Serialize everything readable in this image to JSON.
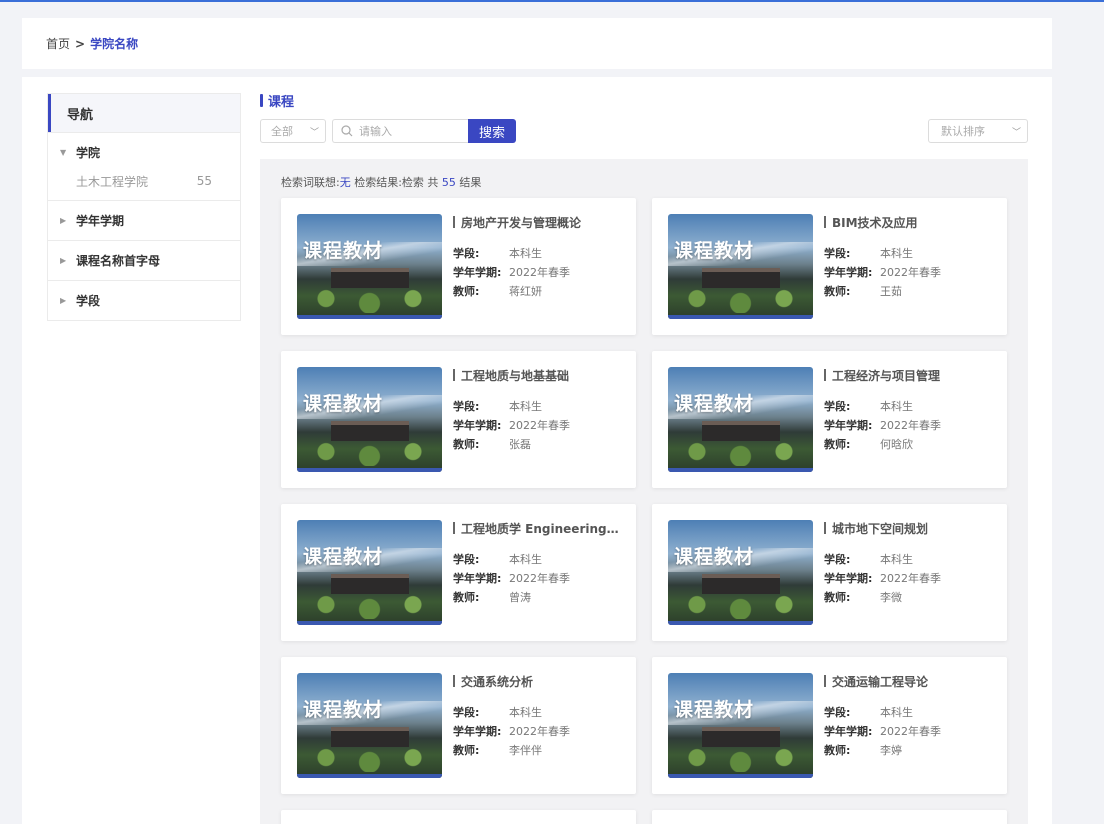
{
  "breadcrumb": {
    "home": "首页",
    "separator": ">",
    "current": "学院名称"
  },
  "sidebar": {
    "title": "导航",
    "groups": [
      {
        "label": "学院",
        "expanded": true,
        "items": [
          {
            "label": "土木工程学院",
            "count": "55"
          }
        ]
      },
      {
        "label": "学年学期",
        "expanded": false
      },
      {
        "label": "课程名称首字母",
        "expanded": false
      },
      {
        "label": "学段",
        "expanded": false
      }
    ]
  },
  "content": {
    "title": "课程",
    "filter_select": "全部",
    "search_placeholder": "请输入",
    "search_button": "搜索",
    "sort_select": "默认排序"
  },
  "summary": {
    "prefix": "检索词联想:",
    "suggest": "无",
    "middle": " 检索结果:检索 共 ",
    "count": "55",
    "suffix": " 结果"
  },
  "meta_labels": {
    "stage": "学段:",
    "term": "学年学期:",
    "teacher": "教师:"
  },
  "thumb_label": "课程教材",
  "courses": [
    {
      "title": "房地产开发与管理概论",
      "stage": "本科生",
      "term": "2022年春季",
      "teacher": "蒋红妍"
    },
    {
      "title": "BIM技术及应用",
      "stage": "本科生",
      "term": "2022年春季",
      "teacher": "王茹"
    },
    {
      "title": "工程地质与地基基础",
      "stage": "本科生",
      "term": "2022年春季",
      "teacher": "张磊"
    },
    {
      "title": "工程经济与项目管理",
      "stage": "本科生",
      "term": "2022年春季",
      "teacher": "何晗欣"
    },
    {
      "title": "工程地质学 Engineering…",
      "stage": "本科生",
      "term": "2022年春季",
      "teacher": "曾涛"
    },
    {
      "title": "城市地下空间规划",
      "stage": "本科生",
      "term": "2022年春季",
      "teacher": "李微"
    },
    {
      "title": "交通系统分析",
      "stage": "本科生",
      "term": "2022年春季",
      "teacher": "李伴伴"
    },
    {
      "title": "交通运输工程导论",
      "stage": "本科生",
      "term": "2022年春季",
      "teacher": "李婷"
    }
  ]
}
